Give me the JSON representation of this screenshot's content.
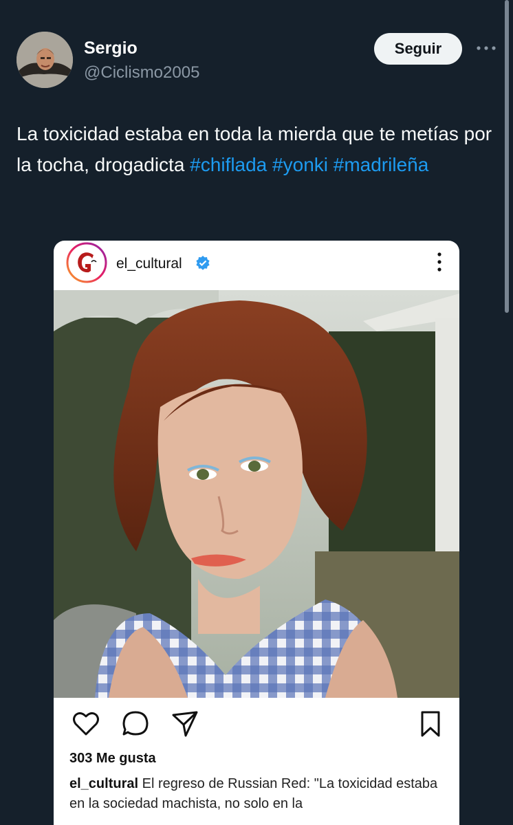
{
  "author": {
    "name": "Sergio",
    "handle": "@Ciclismo2005",
    "follow_label": "Seguir",
    "more_icon": "more-horizontal-icon"
  },
  "tweet": {
    "text": "La toxicidad estaba en toda la mierda que te metías por la tocha, drogadicta",
    "hashtags": [
      "#chiflada",
      "#yonki",
      "#madrileña"
    ]
  },
  "instagram_post": {
    "username": "el_cultural",
    "verified": true,
    "likes": "303 Me gusta",
    "caption_user": "el_cultural",
    "caption_text": "El regreso de Russian Red: \"La toxicidad estaba en la sociedad machista, no solo en la",
    "icons": [
      "heart-icon",
      "comment-icon",
      "share-icon",
      "bookmark-icon"
    ]
  },
  "colors": {
    "background": "#15202b",
    "accent": "#1d9bf0",
    "secondary_text": "#8b98a5"
  }
}
